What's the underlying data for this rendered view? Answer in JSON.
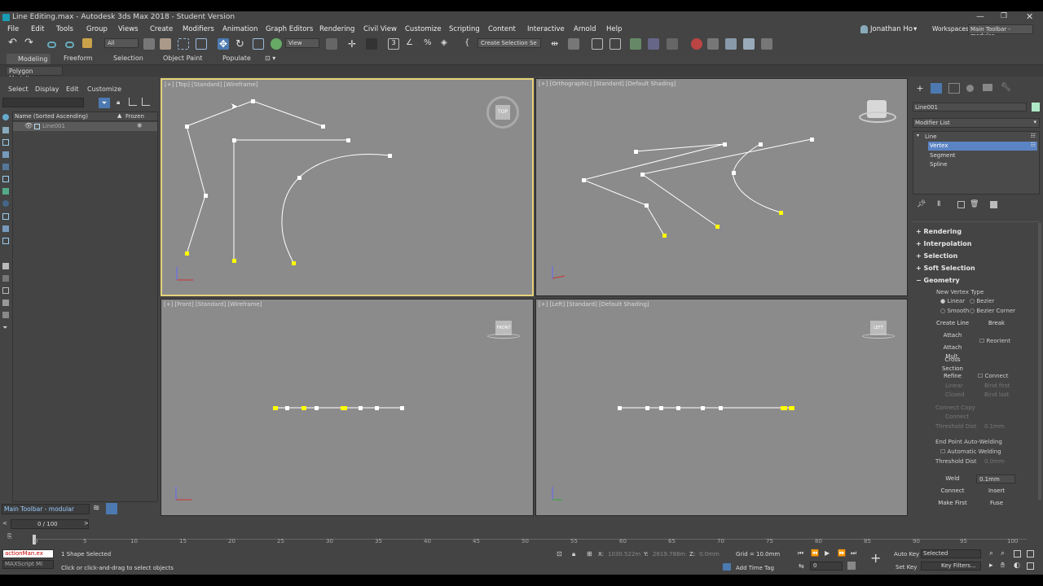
{
  "window": {
    "title": "Line Editing.max - Autodesk 3ds Max 2018 - Student Version"
  },
  "menu": [
    "File",
    "Edit",
    "Tools",
    "Group",
    "Views",
    "Create",
    "Modifiers",
    "Animation",
    "Graph Editors",
    "Rendering",
    "Civil View",
    "Customize",
    "Scripting",
    "Content",
    "Interactive",
    "Arnold",
    "Help"
  ],
  "user": {
    "name": "Jonathan Ho",
    "workspace_label": "Workspaces:",
    "workspace_value": "Main Toolbar - modular"
  },
  "toolbar": {
    "filter": "All",
    "coord": "View",
    "selection_set": "Create Selection Se"
  },
  "ribbon": {
    "tabs": [
      "Modeling",
      "Freeform",
      "Selection",
      "Object Paint",
      "Populate"
    ],
    "sub": "Polygon Modeling"
  },
  "scene_explorer": {
    "menu": [
      "Select",
      "Display",
      "Edit",
      "Customize"
    ],
    "col_name": "Name (Sorted Ascending)",
    "col_frozen": "Frozen",
    "item": "Line001"
  },
  "viewports": {
    "top": "[+] [Top] [Standard] [Wireframe]",
    "ortho": "[+] [Orthographic] [Standard] [Default Shading]",
    "front": "[+] [Front] [Standard] [Wireframe]",
    "left": "[+] [Left] [Standard] [Default Shading]",
    "cube_top": "TOP",
    "cube_front": "FRONT",
    "cube_left": "LEFT"
  },
  "command_panel": {
    "object_name": "Line001",
    "modifier_list": "Modifier List",
    "stack": [
      "Line",
      "Vertex",
      "Segment",
      "Spline"
    ],
    "rollouts": [
      "Rendering",
      "Interpolation",
      "Selection",
      "Soft Selection",
      "Geometry"
    ],
    "geometry": {
      "new_vertex_type": "New Vertex Type",
      "linear": "Linear",
      "bezier": "Bezier",
      "smooth": "Smooth",
      "bezier_corner": "Bezier Corner",
      "create_line": "Create Line",
      "break": "Break",
      "attach": "Attach",
      "attach_mult": "Attach Mult.",
      "reorient": "Reorient",
      "cross_section": "Cross Section",
      "refine": "Refine",
      "connect": "Connect",
      "linear2": "Linear",
      "bind_first": "Bind first",
      "closed": "Closed",
      "bind_last": "Bind last",
      "connect_copy": "Connect Copy",
      "connect2": "Connect",
      "threshold": "Threshold Dist",
      "threshold_val": "0.1mm",
      "end_point": "End Point Auto-Welding",
      "auto_weld": "Automatic Welding",
      "threshold2": "Threshold Dist",
      "threshold_val2": "0.0mm",
      "weld": "Weld",
      "weld_val": "0.1mm",
      "connect3": "Connect",
      "insert": "Insert",
      "make_first": "Make First",
      "fuse": "Fuse"
    }
  },
  "layer_toolbar": "Main Toolbar - modular",
  "timeline": {
    "frame": "0 / 100",
    "ticks": [
      "0",
      "5",
      "10",
      "15",
      "20",
      "25",
      "30",
      "35",
      "40",
      "45",
      "50",
      "55",
      "60",
      "65",
      "70",
      "75",
      "80",
      "85",
      "90",
      "95",
      "100"
    ]
  },
  "status": {
    "script": "actionMan.ex",
    "maxscript": "MAXScript Mi",
    "selected": "1 Shape Selected",
    "prompt": "Click or click-and-drag to select objects",
    "x_label": "X:",
    "x": "1030.522m",
    "y_label": "Y:",
    "y": "2619.788m",
    "z_label": "Z:",
    "z": "0.0mm",
    "grid": "Grid = 10.0mm",
    "add_time_tag": "Add Time Tag",
    "auto_key": "Auto Key",
    "selected_dd": "Selected",
    "set_key": "Set Key",
    "key_filters": "Key Filters...",
    "frame_val": "0"
  }
}
